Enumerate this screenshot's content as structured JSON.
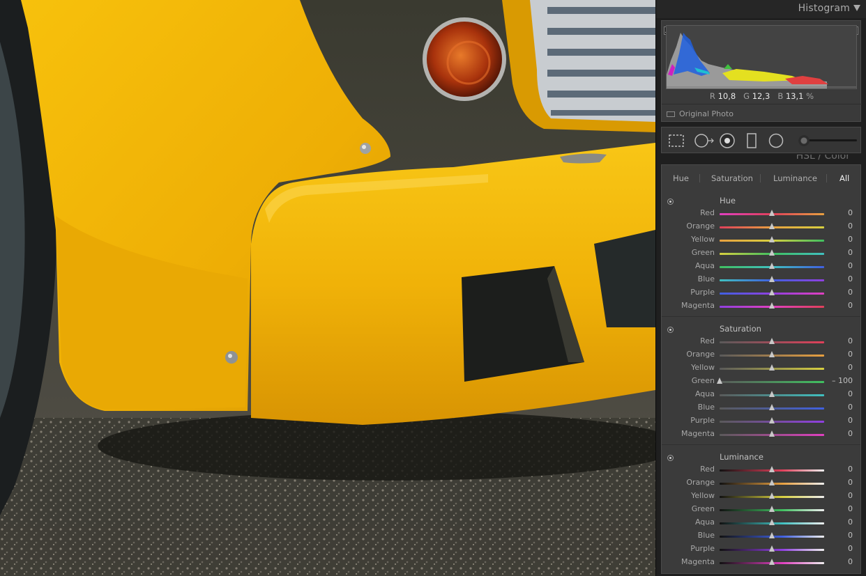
{
  "histogram": {
    "title": "Histogram",
    "readout": {
      "r_label": "R",
      "r": "10,8",
      "g_label": "G",
      "g": "12,3",
      "b_label": "B",
      "b": "13,1",
      "unit": "%"
    },
    "original_photo_label": "Original Photo"
  },
  "toolstrip": {
    "tools": [
      "crop-overlay-icon",
      "spot-removal-icon",
      "red-eye-icon",
      "graduated-filter-icon",
      "radial-filter-icon",
      "adjustment-brush-icon"
    ]
  },
  "hsl": {
    "header": "HSL / Color",
    "tabs": [
      {
        "label": "Hue",
        "active": false
      },
      {
        "label": "Saturation",
        "active": false
      },
      {
        "label": "Luminance",
        "active": false
      },
      {
        "label": "All",
        "active": true
      }
    ],
    "sections": [
      {
        "title": "Hue",
        "rows": [
          {
            "label": "Red",
            "value": "0",
            "level": 0
          },
          {
            "label": "Orange",
            "value": "0",
            "level": 0
          },
          {
            "label": "Yellow",
            "value": "0",
            "level": 0
          },
          {
            "label": "Green",
            "value": "0",
            "level": 0
          },
          {
            "label": "Aqua",
            "value": "0",
            "level": 0
          },
          {
            "label": "Blue",
            "value": "0",
            "level": 0
          },
          {
            "label": "Purple",
            "value": "0",
            "level": 0
          },
          {
            "label": "Magenta",
            "value": "0",
            "level": 0
          }
        ]
      },
      {
        "title": "Saturation",
        "rows": [
          {
            "label": "Red",
            "value": "0",
            "level": 0
          },
          {
            "label": "Orange",
            "value": "0",
            "level": 0
          },
          {
            "label": "Yellow",
            "value": "0",
            "level": 0
          },
          {
            "label": "Green",
            "value": "– 100",
            "level": -100
          },
          {
            "label": "Aqua",
            "value": "0",
            "level": 0
          },
          {
            "label": "Blue",
            "value": "0",
            "level": 0
          },
          {
            "label": "Purple",
            "value": "0",
            "level": 0
          },
          {
            "label": "Magenta",
            "value": "0",
            "level": 0
          }
        ]
      },
      {
        "title": "Luminance",
        "rows": [
          {
            "label": "Red",
            "value": "0",
            "level": 0
          },
          {
            "label": "Orange",
            "value": "0",
            "level": 0
          },
          {
            "label": "Yellow",
            "value": "0",
            "level": 0
          },
          {
            "label": "Green",
            "value": "0",
            "level": 0
          },
          {
            "label": "Aqua",
            "value": "0",
            "level": 0
          },
          {
            "label": "Blue",
            "value": "0",
            "level": 0
          },
          {
            "label": "Purple",
            "value": "0",
            "level": 0
          },
          {
            "label": "Magenta",
            "value": "0",
            "level": 0
          }
        ]
      }
    ]
  },
  "colors": {
    "panel_bg": "#1f1f1f",
    "box_bg": "#3b3b3b",
    "car_yellow": "#f2b705",
    "hue_red": "#e0405a",
    "hue_orange": "#e8a040",
    "hue_yellow": "#d8d040",
    "hue_green": "#40c060",
    "hue_aqua": "#40c0c0",
    "hue_blue": "#4060e0",
    "hue_purple": "#9040e0",
    "hue_magenta": "#e040c0"
  }
}
